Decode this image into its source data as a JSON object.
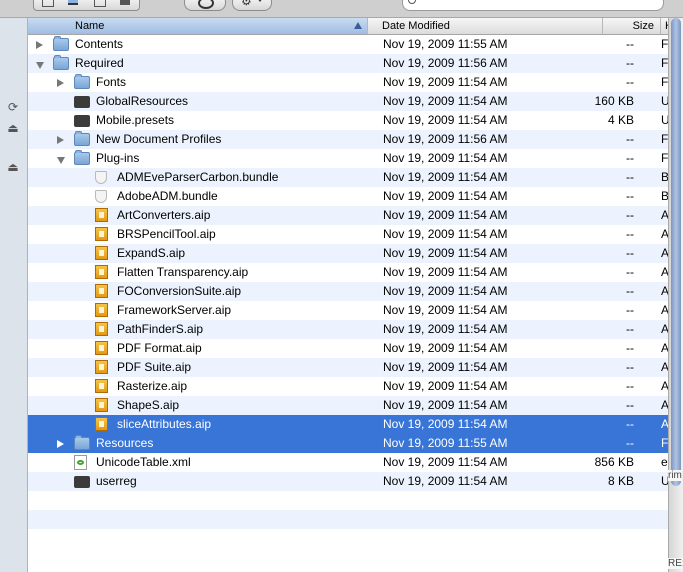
{
  "columns": {
    "name": "Name",
    "date": "Date Modified",
    "size": "Size",
    "kind": "K"
  },
  "rows": [
    {
      "name": "Contents",
      "date": "Nov 19, 2009 11:55 AM",
      "size": "--",
      "kind": "F",
      "icon": "folder-icon",
      "indent": 0,
      "expander": "right"
    },
    {
      "name": "Required",
      "date": "Nov 19, 2009 11:56 AM",
      "size": "--",
      "kind": "F",
      "icon": "folder-icon",
      "indent": 0,
      "expander": "down"
    },
    {
      "name": "Fonts",
      "date": "Nov 19, 2009 11:54 AM",
      "size": "--",
      "kind": "F",
      "icon": "folder-icon",
      "indent": 1,
      "expander": "right"
    },
    {
      "name": "GlobalResources",
      "date": "Nov 19, 2009 11:54 AM",
      "size": "160 KB",
      "kind": "U",
      "icon": "executable-icon",
      "indent": 1,
      "expander": ""
    },
    {
      "name": "Mobile.presets",
      "date": "Nov 19, 2009 11:54 AM",
      "size": "4 KB",
      "kind": "U",
      "icon": "executable-icon",
      "indent": 1,
      "expander": ""
    },
    {
      "name": "New Document Profiles",
      "date": "Nov 19, 2009 11:56 AM",
      "size": "--",
      "kind": "F",
      "icon": "folder-icon",
      "indent": 1,
      "expander": "right"
    },
    {
      "name": "Plug-ins",
      "date": "Nov 19, 2009 11:54 AM",
      "size": "--",
      "kind": "F",
      "icon": "folder-icon",
      "indent": 1,
      "expander": "down"
    },
    {
      "name": "ADMEveParserCarbon.bundle",
      "date": "Nov 19, 2009 11:54 AM",
      "size": "--",
      "kind": "B",
      "icon": "bundle-icon",
      "indent": 2,
      "expander": ""
    },
    {
      "name": "AdobeADM.bundle",
      "date": "Nov 19, 2009 11:54 AM",
      "size": "--",
      "kind": "B",
      "icon": "bundle-icon",
      "indent": 2,
      "expander": ""
    },
    {
      "name": "ArtConverters.aip",
      "date": "Nov 19, 2009 11:54 AM",
      "size": "--",
      "kind": "A",
      "icon": "plugin-icon",
      "indent": 2,
      "expander": ""
    },
    {
      "name": "BRSPencilTool.aip",
      "date": "Nov 19, 2009 11:54 AM",
      "size": "--",
      "kind": "A",
      "icon": "plugin-icon",
      "indent": 2,
      "expander": ""
    },
    {
      "name": "ExpandS.aip",
      "date": "Nov 19, 2009 11:54 AM",
      "size": "--",
      "kind": "A",
      "icon": "plugin-icon",
      "indent": 2,
      "expander": ""
    },
    {
      "name": "Flatten Transparency.aip",
      "date": "Nov 19, 2009 11:54 AM",
      "size": "--",
      "kind": "A",
      "icon": "plugin-icon",
      "indent": 2,
      "expander": ""
    },
    {
      "name": "FOConversionSuite.aip",
      "date": "Nov 19, 2009 11:54 AM",
      "size": "--",
      "kind": "A",
      "icon": "plugin-icon",
      "indent": 2,
      "expander": ""
    },
    {
      "name": "FrameworkServer.aip",
      "date": "Nov 19, 2009 11:54 AM",
      "size": "--",
      "kind": "A",
      "icon": "plugin-icon",
      "indent": 2,
      "expander": ""
    },
    {
      "name": "PathFinderS.aip",
      "date": "Nov 19, 2009 11:54 AM",
      "size": "--",
      "kind": "A",
      "icon": "plugin-icon",
      "indent": 2,
      "expander": ""
    },
    {
      "name": "PDF Format.aip",
      "date": "Nov 19, 2009 11:54 AM",
      "size": "--",
      "kind": "A",
      "icon": "plugin-icon",
      "indent": 2,
      "expander": ""
    },
    {
      "name": "PDF Suite.aip",
      "date": "Nov 19, 2009 11:54 AM",
      "size": "--",
      "kind": "A",
      "icon": "plugin-icon",
      "indent": 2,
      "expander": ""
    },
    {
      "name": "Rasterize.aip",
      "date": "Nov 19, 2009 11:54 AM",
      "size": "--",
      "kind": "A",
      "icon": "plugin-icon",
      "indent": 2,
      "expander": ""
    },
    {
      "name": "ShapeS.aip",
      "date": "Nov 19, 2009 11:54 AM",
      "size": "--",
      "kind": "A",
      "icon": "plugin-icon",
      "indent": 2,
      "expander": ""
    },
    {
      "name": "sliceAttributes.aip",
      "date": "Nov 19, 2009 11:54 AM",
      "size": "--",
      "kind": "A",
      "icon": "plugin-icon",
      "indent": 2,
      "expander": "",
      "selected": true
    },
    {
      "name": "Resources",
      "date": "Nov 19, 2009 11:55 AM",
      "size": "--",
      "kind": "F",
      "icon": "folder-icon",
      "indent": 1,
      "expander": "right",
      "selected": true
    },
    {
      "name": "UnicodeTable.xml",
      "date": "Nov 19, 2009 11:54 AM",
      "size": "856 KB",
      "kind": "e",
      "icon": "xml-file-icon",
      "indent": 1,
      "expander": ""
    },
    {
      "name": "userreg",
      "date": "Nov 19, 2009 11:54 AM",
      "size": "8 KB",
      "kind": "U",
      "icon": "executable-icon",
      "indent": 1,
      "expander": ""
    }
  ],
  "edge_text": {
    "overlay_1": "rim",
    "overlay_2": "RE:"
  },
  "colors": {
    "selection": "#3875d7",
    "alt_row": "#edf3fe",
    "sidebar": "#dde3ea"
  }
}
